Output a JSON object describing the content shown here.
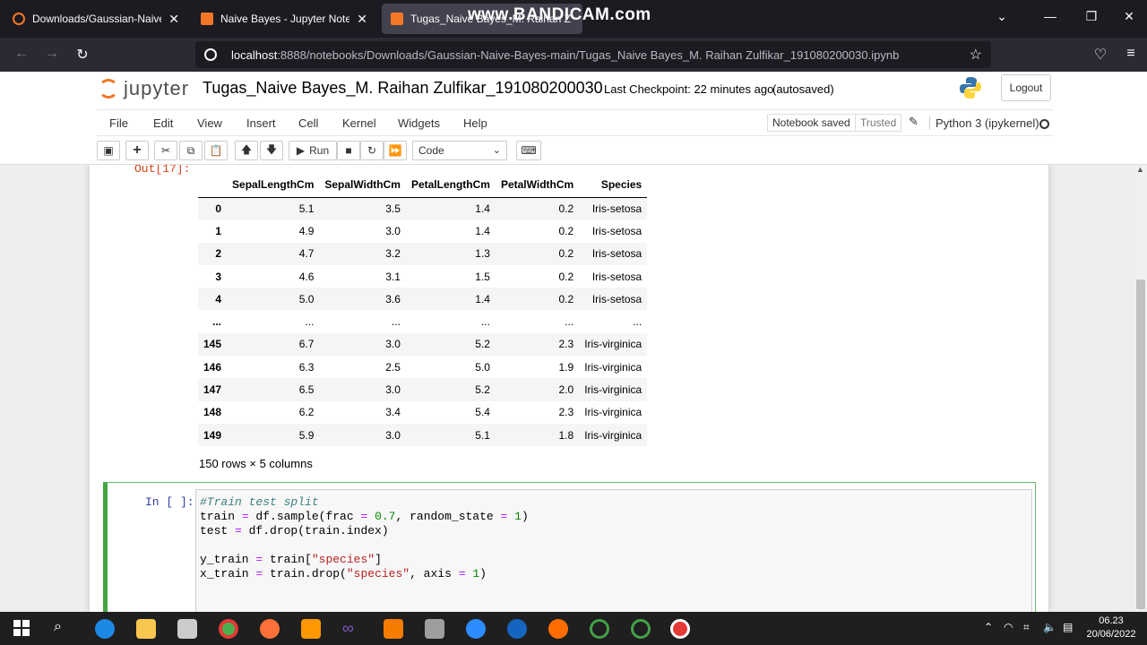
{
  "browser": {
    "watermark": "www.BANDICAM.com",
    "tabs": [
      {
        "title": "Downloads/Gaussian-Naive-Ba",
        "color": "#f37726"
      },
      {
        "title": "Naive Bayes - Jupyter Notebook",
        "color": "#f37726"
      },
      {
        "title": "Tugas_Naive Bayes_M. Raihan Z",
        "color": "#f37726"
      }
    ],
    "url_host": "localhost",
    "url_rest": ":8888/notebooks/Downloads/Gaussian-Naive-Bayes-main/Tugas_Naive Bayes_M. Raihan Zulfikar_191080200030.ipynb"
  },
  "jupyter": {
    "logo_text": "jupyter",
    "notebook_title": "Tugas_Naive Bayes_M. Raihan Zulfikar_191080200030",
    "checkpoint": "Last Checkpoint: 22 minutes ago",
    "autosave": "(autosaved)",
    "logout_label": "Logout",
    "menu": [
      "File",
      "Edit",
      "View",
      "Insert",
      "Cell",
      "Kernel",
      "Widgets",
      "Help"
    ],
    "notebook_saved": "Notebook saved",
    "trusted": "Trusted",
    "kernel": "Python 3 (ipykernel)",
    "run_label": "Run",
    "cell_type": "Code"
  },
  "output": {
    "prompt": "Out[17]:",
    "columns": [
      "",
      "SepalLengthCm",
      "SepalWidthCm",
      "PetalLengthCm",
      "PetalWidthCm",
      "Species"
    ],
    "rows": [
      [
        "0",
        "5.1",
        "3.5",
        "1.4",
        "0.2",
        "Iris-setosa"
      ],
      [
        "1",
        "4.9",
        "3.0",
        "1.4",
        "0.2",
        "Iris-setosa"
      ],
      [
        "2",
        "4.7",
        "3.2",
        "1.3",
        "0.2",
        "Iris-setosa"
      ],
      [
        "3",
        "4.6",
        "3.1",
        "1.5",
        "0.2",
        "Iris-setosa"
      ],
      [
        "4",
        "5.0",
        "3.6",
        "1.4",
        "0.2",
        "Iris-setosa"
      ],
      [
        "...",
        "...",
        "...",
        "...",
        "...",
        "..."
      ],
      [
        "145",
        "6.7",
        "3.0",
        "5.2",
        "2.3",
        "Iris-virginica"
      ],
      [
        "146",
        "6.3",
        "2.5",
        "5.0",
        "1.9",
        "Iris-virginica"
      ],
      [
        "147",
        "6.5",
        "3.0",
        "5.2",
        "2.0",
        "Iris-virginica"
      ],
      [
        "148",
        "6.2",
        "3.4",
        "5.4",
        "2.3",
        "Iris-virginica"
      ],
      [
        "149",
        "5.9",
        "3.0",
        "5.1",
        "1.8",
        "Iris-virginica"
      ]
    ],
    "shape": "150 rows × 5 columns"
  },
  "code_cell": {
    "prompt": "In [ ]:",
    "lines": [
      "#Train test split",
      "train = df.sample(frac = 0.7, random_state = 1)",
      "test = df.drop(train.index)",
      "",
      "y_train = train[\"species\"]",
      "x_train = train.drop(\"species\", axis = 1)"
    ]
  },
  "taskbar": {
    "time": "06.23",
    "date": "20/06/2022"
  }
}
